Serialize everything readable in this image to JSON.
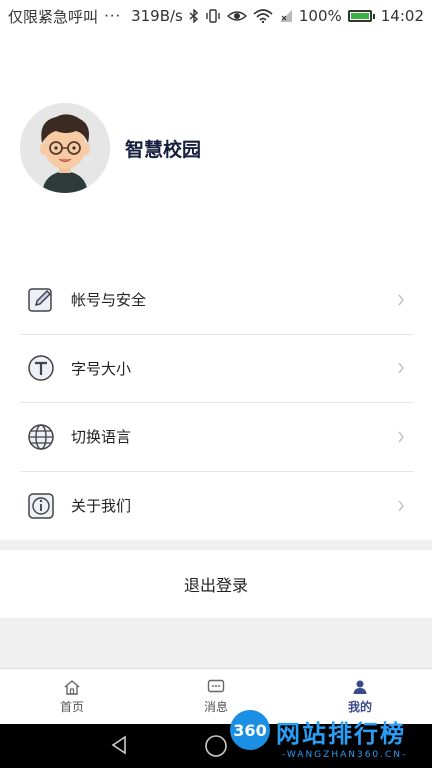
{
  "status_bar": {
    "carrier": "仅限紧急呼叫",
    "dots": "···",
    "speed": "319B/s",
    "battery_text": "100%",
    "time": "14:02"
  },
  "profile": {
    "app_name": "智慧校园"
  },
  "menu": {
    "items": [
      {
        "label": "帐号与安全",
        "icon": "edit-icon"
      },
      {
        "label": "字号大小",
        "icon": "font-size-icon"
      },
      {
        "label": "切换语言",
        "icon": "globe-icon"
      },
      {
        "label": "关于我们",
        "icon": "info-icon"
      }
    ]
  },
  "logout_label": "退出登录",
  "bottom_nav": {
    "tabs": [
      {
        "label": "首页",
        "icon": "home-icon",
        "active": false
      },
      {
        "label": "消息",
        "icon": "message-icon",
        "active": false
      },
      {
        "label": "我的",
        "icon": "user-icon",
        "active": true
      }
    ]
  },
  "watermark": {
    "logo": "360",
    "text": "网站排行榜",
    "sub": "-WANGZHAN360.CN-"
  },
  "colors": {
    "accent": "#3b4a8a",
    "title": "#161e3d",
    "band": "#f0f0f0"
  }
}
